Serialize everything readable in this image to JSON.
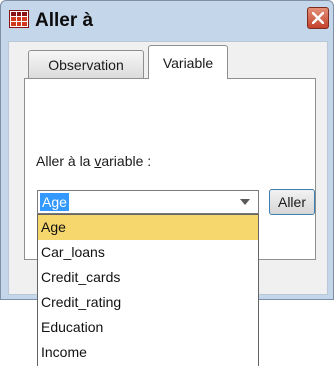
{
  "window": {
    "title": "Aller à",
    "icon": "data-grid-icon",
    "close_icon": "close-icon"
  },
  "tabs": [
    {
      "label": "Observation",
      "active": false
    },
    {
      "label": "Variable",
      "active": true
    }
  ],
  "form": {
    "label_before": "Aller à la ",
    "label_accel": "v",
    "label_after": "ariable :",
    "selected_value": "Age",
    "go_button": "Aller"
  },
  "dropdown": {
    "options": [
      "Age",
      "Car_loans",
      "Credit_cards",
      "Credit_rating",
      "Education",
      "Income"
    ],
    "highlighted": "Age"
  },
  "colors": {
    "frame": "#c4d6ea",
    "selection": "#3399ff",
    "highlight": "#f5d76e",
    "close": "#c2432b"
  }
}
